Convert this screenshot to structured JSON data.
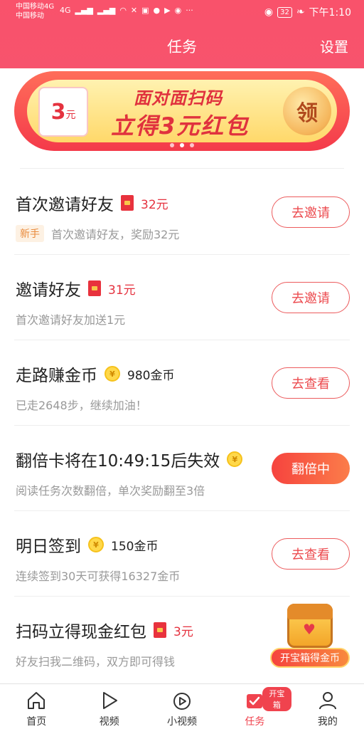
{
  "status_bar": {
    "carrier_1": "中国移动4G",
    "carrier_2": "中国移动",
    "network": "4G",
    "battery": "32",
    "time": "下午1:10"
  },
  "header": {
    "title": "任务",
    "settings_label": "设置"
  },
  "banner": {
    "coupon_amount": "3",
    "coupon_unit": "元",
    "line1": "面对面扫码",
    "line2": "立得3元红包",
    "claim_label": "领",
    "slide_count": 3,
    "active_slide": 1
  },
  "tasks": [
    {
      "title": "首次邀请好友",
      "reward": "32元",
      "reward_type": "redpack",
      "tag": "新手",
      "subtitle": "首次邀请好友，奖励32元",
      "button": "去邀请",
      "button_style": "outline"
    },
    {
      "title": "邀请好友",
      "reward": "31元",
      "reward_type": "redpack",
      "subtitle": "首次邀请好友加送1元",
      "button": "去邀请",
      "button_style": "outline"
    },
    {
      "title": "走路赚金币",
      "reward": "980金币",
      "reward_type": "coin",
      "subtitle": "已走2648步，继续加油！",
      "button": "去查看",
      "button_style": "outline"
    },
    {
      "title": "翻倍卡将在10:49:15后失效",
      "reward": "",
      "reward_type": "coin",
      "subtitle": "阅读任务次数翻倍，单次奖励翻至3倍",
      "button": "翻倍中",
      "button_style": "filled"
    },
    {
      "title": "明日签到",
      "reward": "150金币",
      "reward_type": "coin",
      "subtitle": "连续签到30天可获得16327金币",
      "button": "去查看",
      "button_style": "outline"
    },
    {
      "title": "扫码立得现金红包",
      "reward": "3元",
      "reward_type": "redpack",
      "subtitle": "好友扫我二维码，双方即可得钱",
      "button": "",
      "button_style": "chest"
    }
  ],
  "treasure_chest": {
    "label": "开宝箱得金币"
  },
  "bottom_nav": {
    "items": [
      {
        "label": "首页",
        "icon": "home-icon"
      },
      {
        "label": "视频",
        "icon": "play-icon"
      },
      {
        "label": "小视频",
        "icon": "short-video-icon"
      },
      {
        "label": "任务",
        "icon": "task-icon",
        "badge": "开宝箱",
        "active": true
      },
      {
        "label": "我的",
        "icon": "profile-icon"
      }
    ]
  },
  "colors": {
    "brand": "#f7536d",
    "accent": "#f0434e",
    "coin": "#ffd84a"
  }
}
